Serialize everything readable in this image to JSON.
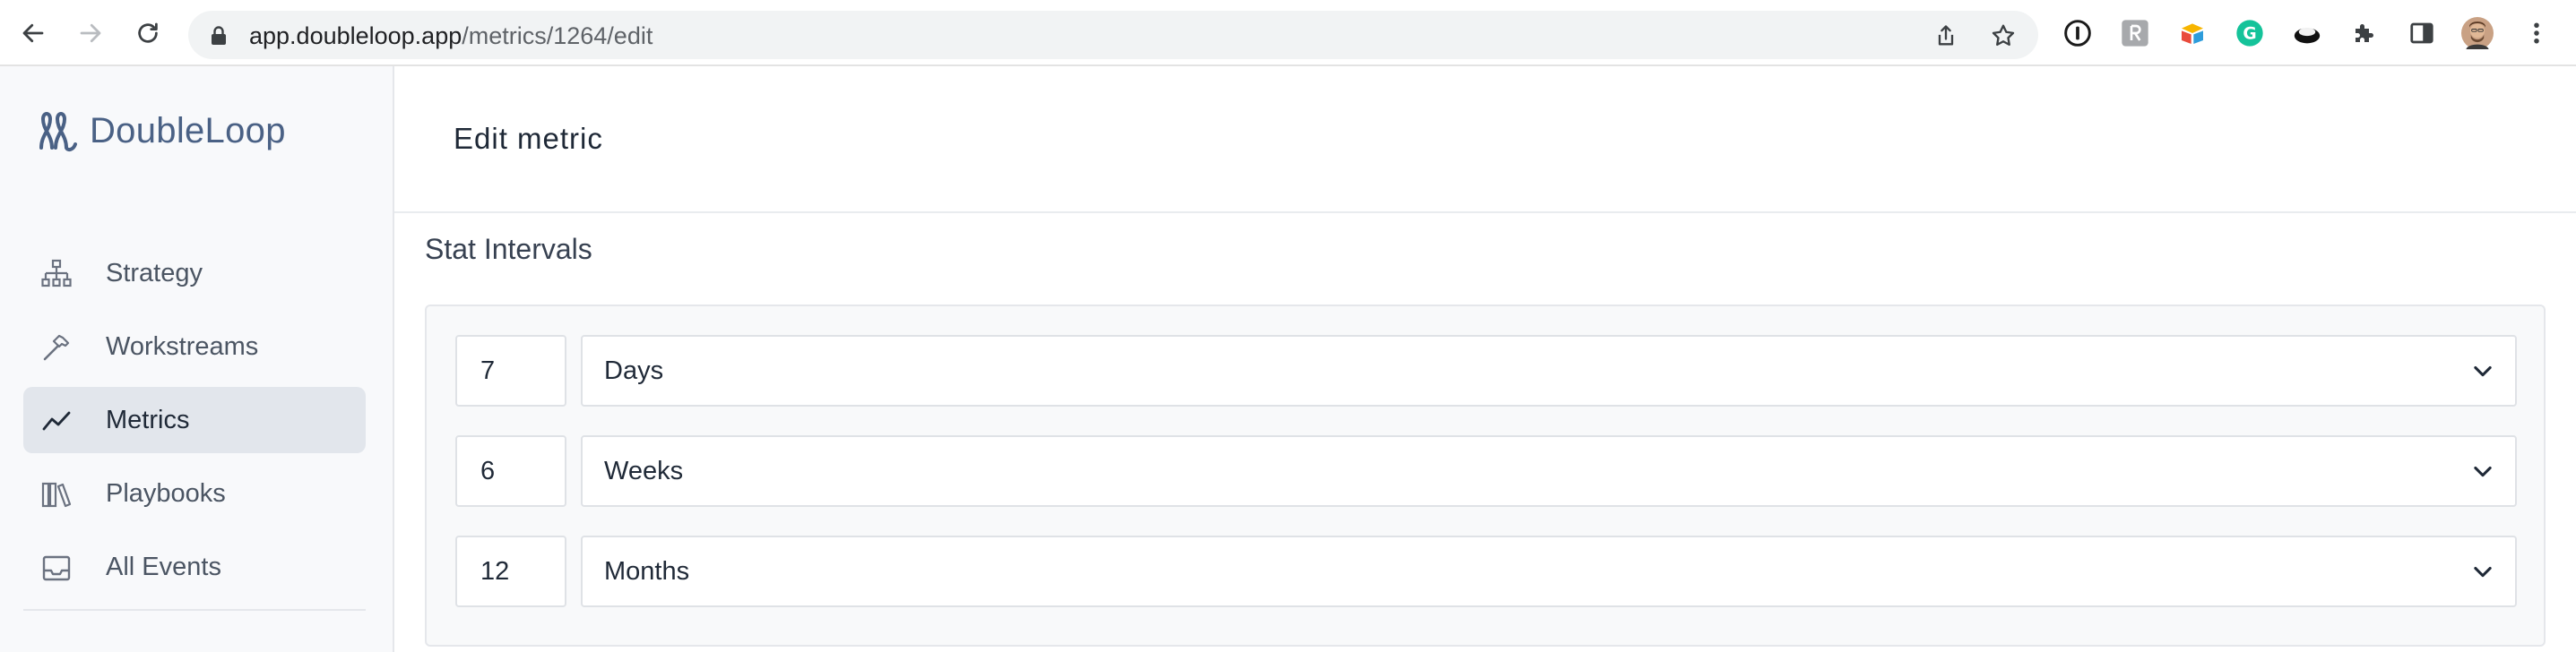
{
  "browser": {
    "url_host": "app.doubleloop.app",
    "url_path": "/metrics/1264/edit",
    "icons": [
      "back-arrow-icon",
      "forward-arrow-icon",
      "reload-icon",
      "lock-icon",
      "share-icon",
      "star-icon",
      "onepassword-extension-icon",
      "tiny-r-extension-icon",
      "pinwheel-extension-icon",
      "grammarly-extension-icon",
      "record-extension-icon",
      "puzzle-extensions-icon",
      "side-panel-icon",
      "profile-avatar",
      "kebab-menu-icon"
    ]
  },
  "sidebar": {
    "brand": "DoubleLoop",
    "items": [
      {
        "label": "Strategy",
        "icon": "hierarchy-icon",
        "active": false
      },
      {
        "label": "Workstreams",
        "icon": "hammer-icon",
        "active": false
      },
      {
        "label": "Metrics",
        "icon": "trend-line-icon",
        "active": true
      },
      {
        "label": "Playbooks",
        "icon": "books-icon",
        "active": false
      },
      {
        "label": "All Events",
        "icon": "inbox-icon",
        "active": false
      }
    ]
  },
  "main": {
    "title": "Edit metric",
    "section_title": "Stat Intervals",
    "intervals": [
      {
        "count": "7",
        "unit": "Days"
      },
      {
        "count": "6",
        "unit": "Weeks"
      },
      {
        "count": "12",
        "unit": "Months"
      }
    ]
  },
  "colors": {
    "brand": "#4a6185",
    "active_nav_bg": "#e2e6ec",
    "sidebar_bg": "#f8f9fb",
    "panel_bg": "#f8f9fa"
  }
}
